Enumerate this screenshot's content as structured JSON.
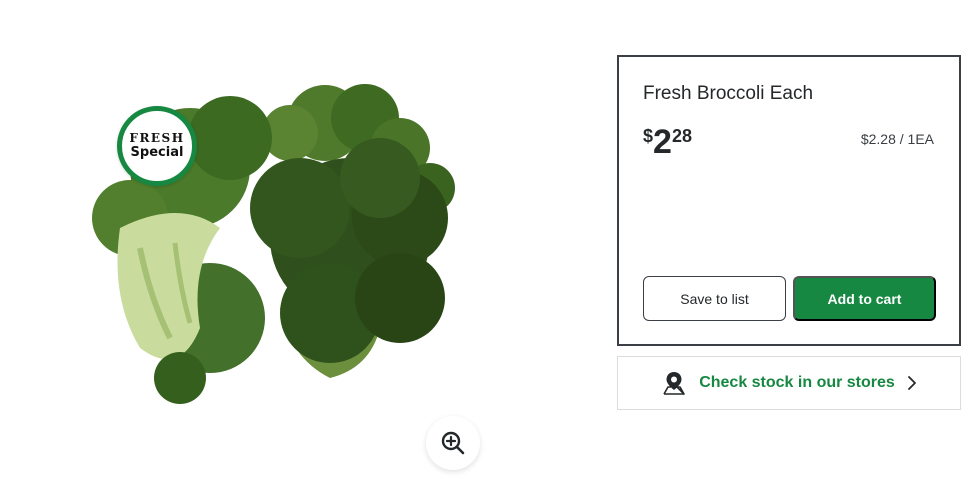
{
  "product": {
    "badge_line1": "FRESH",
    "badge_line2": "Special",
    "title": "Fresh Broccoli Each",
    "price_dollar_sign": "$",
    "price_whole": "2",
    "price_cents": "28",
    "unit_price": "$2.28 / 1EA",
    "image_icon": "broccoli-photo",
    "zoom_icon": "zoom-in-icon"
  },
  "actions": {
    "save_label": "Save to list",
    "cart_label": "Add to cart"
  },
  "stock": {
    "label": "Check stock in our stores",
    "icon": "map-pin-icon",
    "chevron_icon": "chevron-right-icon"
  },
  "colors": {
    "brand_green": "#178841",
    "text_dark": "#25282a",
    "card_border": "#3a4046"
  }
}
